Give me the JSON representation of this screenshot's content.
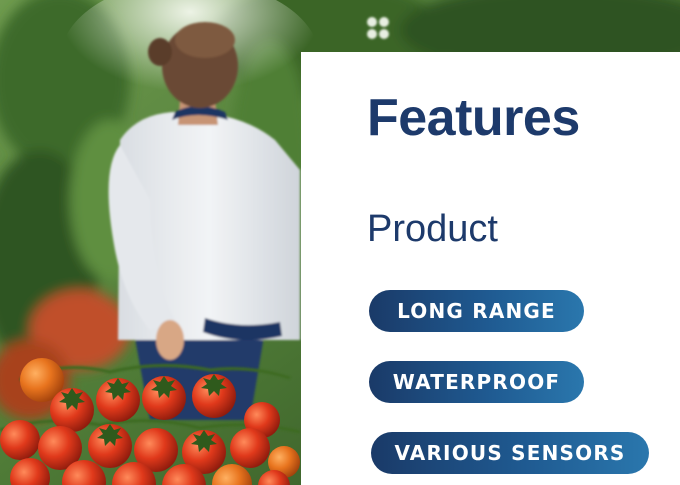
{
  "features": {
    "title": "Features",
    "subtitle": "Product",
    "tags": [
      {
        "label": "LONG RANGE"
      },
      {
        "label": "WATERPROOF"
      },
      {
        "label": "VARIOUS SENSORS"
      }
    ]
  },
  "photo": {
    "subject": "worker-in-greenhouse-with-tomatoes"
  },
  "colors": {
    "heading": "#1d3a6b",
    "pill_start": "#1a3a68",
    "pill_end": "#2a77ad",
    "panel_bg": "#ffffff"
  }
}
